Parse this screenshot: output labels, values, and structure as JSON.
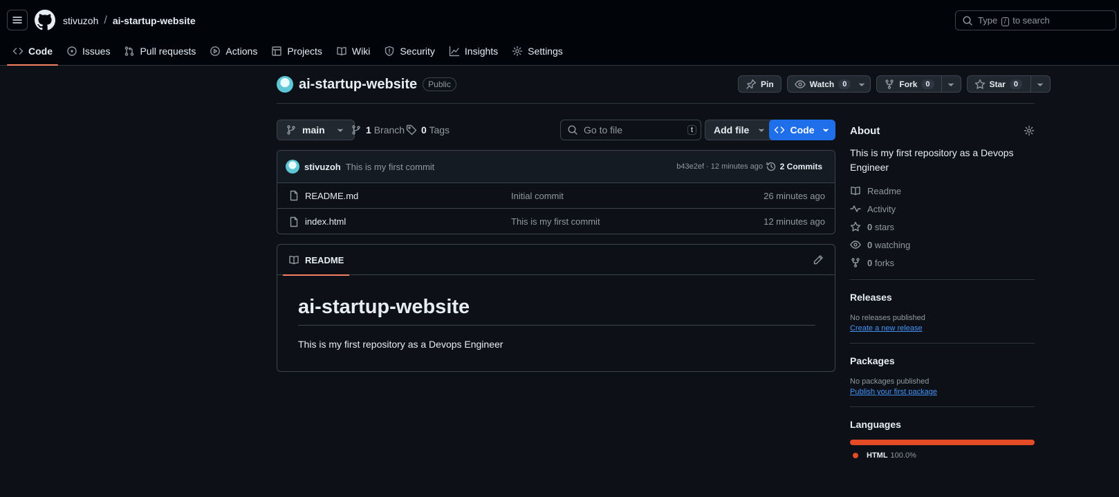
{
  "nav": {
    "owner": "stivuzoh",
    "separator": "/",
    "repo": "ai-startup-website",
    "search_prefix": "Type",
    "search_key": "/",
    "search_suffix": "to search",
    "tabs": [
      {
        "label": "Code",
        "icon": "code-icon"
      },
      {
        "label": "Issues",
        "icon": "issue-icon"
      },
      {
        "label": "Pull requests",
        "icon": "pull-request-icon"
      },
      {
        "label": "Actions",
        "icon": "play-icon"
      },
      {
        "label": "Projects",
        "icon": "table-icon"
      },
      {
        "label": "Wiki",
        "icon": "book-icon"
      },
      {
        "label": "Security",
        "icon": "shield-icon"
      },
      {
        "label": "Insights",
        "icon": "graph-icon"
      },
      {
        "label": "Settings",
        "icon": "gear-icon"
      }
    ]
  },
  "repo_header": {
    "name": "ai-startup-website",
    "visibility": "Public",
    "pin_label": "Pin",
    "watch_label": "Watch",
    "watch_count": "0",
    "fork_label": "Fork",
    "fork_count": "0",
    "star_label": "Star",
    "star_count": "0"
  },
  "file_bar": {
    "branch": "main",
    "branch_count": "1",
    "branch_label": "Branch",
    "tag_count": "0",
    "tag_label": "Tags",
    "goto_placeholder": "Go to file",
    "goto_key": "t",
    "add_file_label": "Add file",
    "code_label": "Code"
  },
  "latest_commit": {
    "author": "stivuzoh",
    "message": "This is my first commit",
    "meta": "b43e2ef · 12 minutes ago",
    "commits_label": "2 Commits"
  },
  "files": [
    {
      "name": "README.md",
      "message": "Initial commit",
      "age": "26 minutes ago"
    },
    {
      "name": "index.html",
      "message": "This is my first commit",
      "age": "12 minutes ago"
    }
  ],
  "readme": {
    "tab_label": "README",
    "heading": "ai-startup-website",
    "body": "This is my first repository as a Devops Engineer"
  },
  "about": {
    "title": "About",
    "description": "This is my first repository as a Devops Engineer",
    "readme_label": "Readme",
    "activity_label": "Activity",
    "stars_count": "0",
    "stars_label": "stars",
    "watching_count": "0",
    "watching_label": "watching",
    "forks_count": "0",
    "forks_label": "forks"
  },
  "releases": {
    "title": "Releases",
    "empty_text": "No releases published",
    "link": "Create a new release"
  },
  "packages": {
    "title": "Packages",
    "empty_text": "No packages published",
    "link": "Publish your first package"
  },
  "languages": {
    "title": "Languages",
    "items": [
      {
        "name": "HTML",
        "percent": "100.0%",
        "fraction": 1.0,
        "color": "#e34c26"
      }
    ]
  },
  "colors": {
    "background": "#0d1117",
    "header_background": "#010409",
    "accent_underline": "#f78166",
    "primary_button": "#1f6feb",
    "link": "#4493f8",
    "html_language": "#e34c26"
  }
}
